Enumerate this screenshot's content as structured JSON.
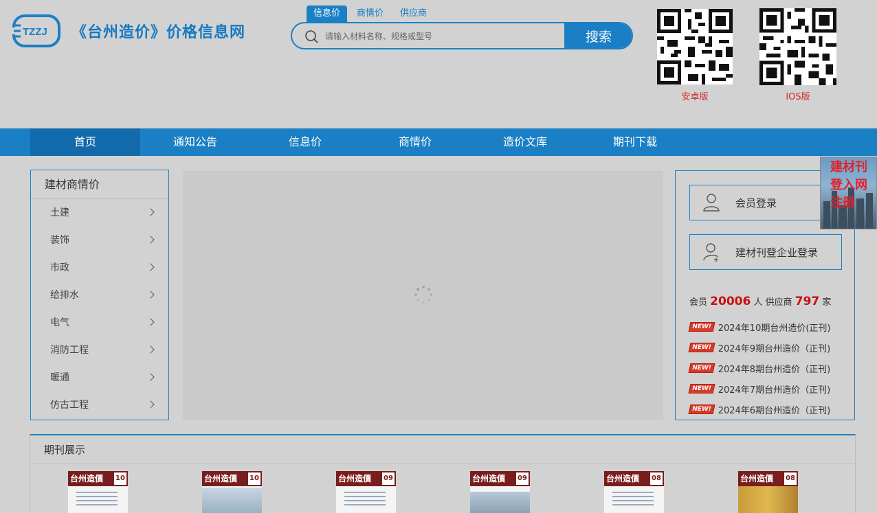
{
  "brand": {
    "logo_text": "TZZJ",
    "title": "《台州造价》价格信息网"
  },
  "search": {
    "tabs": [
      {
        "label": "信息价",
        "active": true
      },
      {
        "label": "商情价",
        "active": false
      },
      {
        "label": "供应商",
        "active": false
      }
    ],
    "placeholder": "请输入材料名称、规格或型号",
    "button_label": "搜索"
  },
  "qr_codes": [
    {
      "label": "安卓版"
    },
    {
      "label": "IOS版"
    }
  ],
  "nav": {
    "items": [
      {
        "label": "首页",
        "active": true
      },
      {
        "label": "通知公告",
        "active": false
      },
      {
        "label": "信息价",
        "active": false
      },
      {
        "label": "商情价",
        "active": false
      },
      {
        "label": "造价文库",
        "active": false
      },
      {
        "label": "期刊下载",
        "active": false
      }
    ]
  },
  "sidebar": {
    "title": "建材商情价",
    "items": [
      {
        "label": "土建"
      },
      {
        "label": "装饰"
      },
      {
        "label": "市政"
      },
      {
        "label": "给排水"
      },
      {
        "label": "电气"
      },
      {
        "label": "消防工程"
      },
      {
        "label": "暖通"
      },
      {
        "label": "仿古工程"
      }
    ]
  },
  "right_panel": {
    "member_login": "会员登录",
    "enterprise_login": "建材刊登企业登录",
    "stats": {
      "member_prefix": "会员",
      "member_count": "20006",
      "member_unit": "人",
      "supplier_prefix": "供应商",
      "supplier_count": "797",
      "supplier_unit": "家"
    },
    "news_badge": "NEW!",
    "news": [
      {
        "title": "2024年10期台州造价(正刊)"
      },
      {
        "title": "2024年9期台州造价（正刊)"
      },
      {
        "title": "2024年8期台州造价（正刊)"
      },
      {
        "title": "2024年7期台州造价（正刊)"
      },
      {
        "title": "2024年6期台州造价（正刊)"
      }
    ]
  },
  "float_ad": {
    "text": "建材刊登入网注册"
  },
  "journal": {
    "title": "期刊展示",
    "covers": [
      {
        "title": "台州造價",
        "issue": "10"
      },
      {
        "title": "台州造價",
        "issue": "10"
      },
      {
        "title": "台州造價",
        "issue": "09"
      },
      {
        "title": "台州造價",
        "issue": "09"
      },
      {
        "title": "台州造價",
        "issue": "08"
      },
      {
        "title": "台州造價",
        "issue": "08"
      }
    ]
  },
  "colors": {
    "accent": "#1a7fc5",
    "highlight": "#c81010",
    "qr_label": "#d42a2a"
  }
}
